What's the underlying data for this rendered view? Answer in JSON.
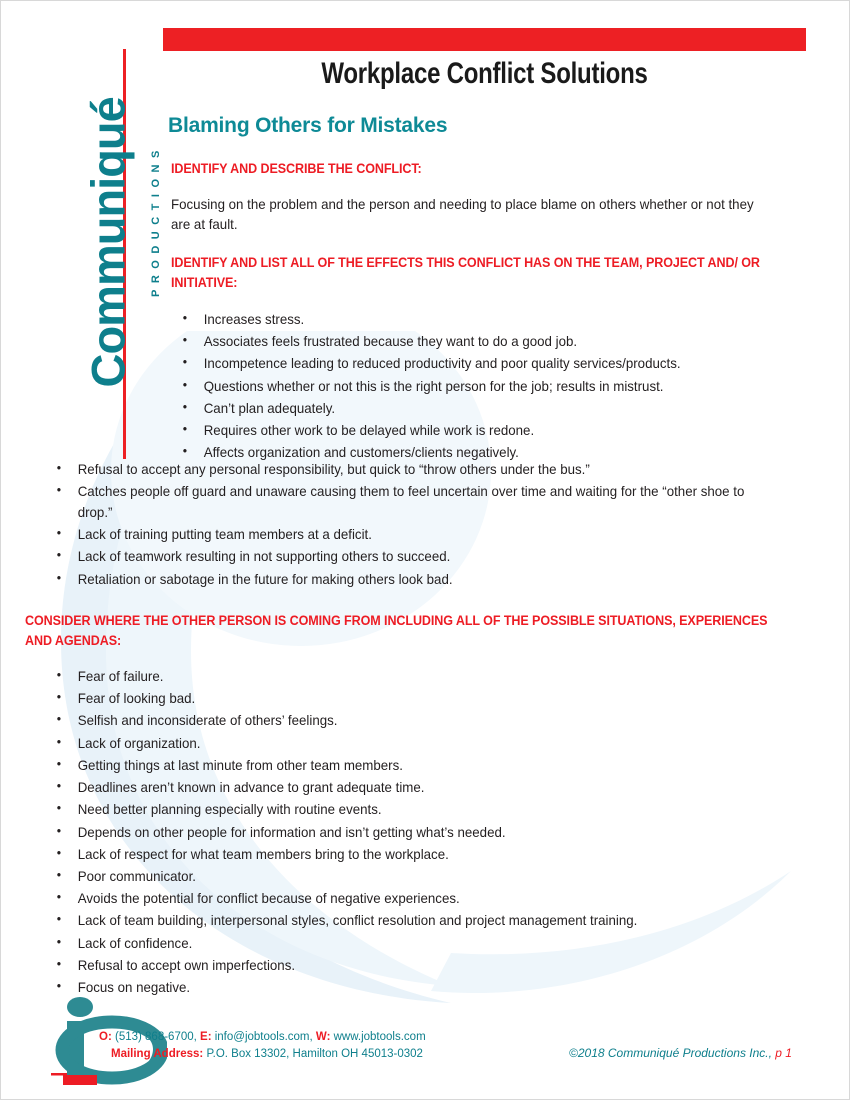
{
  "brand": {
    "name": "Communiqué",
    "subtitle": "PRODUCTIONS"
  },
  "header": {
    "title": "Workplace Conflict Solutions",
    "subtitle": "Blaming Others for Mistakes",
    "bar_color": "#ed2024"
  },
  "colors": {
    "red": "#ed1c24",
    "teal": "#0e8a96",
    "text": "#231f20",
    "watermark": "#e4f0f7"
  },
  "sections": {
    "identify_conflict": {
      "heading": "IDENTIFY AND DESCRIBE THE CONFLICT:",
      "body": "Focusing on the problem and the person and needing to place blame on others whether or not they are at fault."
    },
    "effects": {
      "heading": "IDENTIFY AND LIST ALL OF THE EFFECTS THIS CONFLICT HAS ON THE TEAM, PROJECT AND/ OR INITIATIVE:",
      "items": [
        "Increases stress.",
        "Associates feels frustrated because they want to do a good job.",
        "Incompetence leading to reduced productivity and poor quality services/products.",
        "Questions whether or not this is the right person for the job; results in mistrust.",
        "Can’t plan adequately.",
        "Requires other work to be delayed while work is redone.",
        "Affects organization and customers/clients negatively."
      ],
      "items_outdent": [
        "Refusal to accept any personal responsibility, but quick to “throw others under the bus.”",
        "Catches people off guard and unaware causing them to feel uncertain over time and waiting for the “other shoe to drop.”",
        "Lack of training putting team members at a deficit.",
        "Lack of teamwork resulting in not supporting others to succeed.",
        "Retaliation or sabotage in the future for making others look bad."
      ]
    },
    "consider": {
      "heading": "CONSIDER WHERE THE OTHER PERSON IS COMING FROM INCLUDING ALL OF THE POSSIBLE SITUATIONS, EXPERIENCES AND AGENDAS:",
      "items": [
        "Fear of failure.",
        "Fear of looking bad.",
        "Selfish and inconsiderate of others’ feelings.",
        "Lack of organization.",
        "Getting things at last minute from other team members.",
        "Deadlines aren’t known in advance to grant adequate time.",
        "Need better planning especially with routine events.",
        "Depends on other people for information and isn’t getting what’s needed.",
        "Lack of respect for what team members bring to the workplace.",
        "Poor communicator.",
        "Avoids the potential for conflict because of negative experiences.",
        "Lack of team building, interpersonal styles, conflict resolution and project management training.",
        "Lack of confidence.",
        "Refusal to accept own imperfections.",
        "Focus on negative."
      ]
    }
  },
  "footer": {
    "office_label": "O:",
    "office_value": "(513) 868-6700,",
    "email_label": "E:",
    "email_value": "info@jobtools.com,",
    "web_label": "W:",
    "web_value": "www.jobtools.com",
    "address_label": "Mailing Address:",
    "address_value": "P.O. Box 13302, Hamilton  OH 45013-0302",
    "copyright": "©2018 Communiqué Productions Inc.,",
    "page_number": "p 1"
  }
}
